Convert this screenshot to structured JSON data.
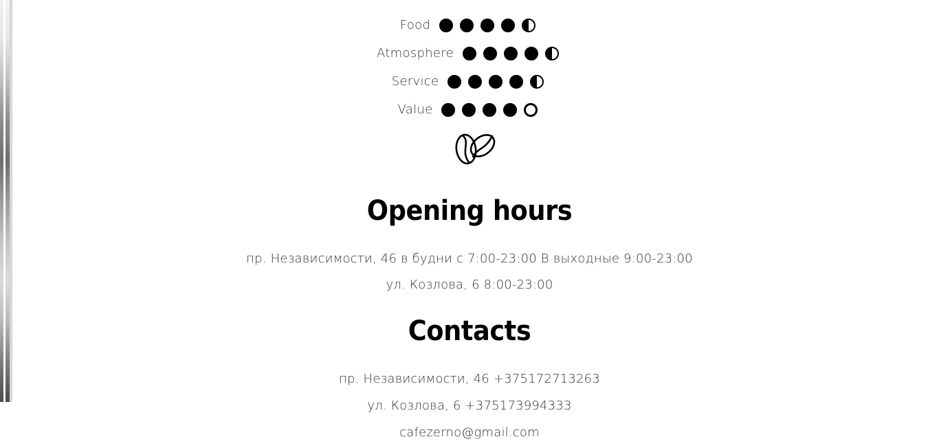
{
  "ratings": [
    {
      "label": "Food",
      "score": 4.5
    },
    {
      "label": "Atmosphere",
      "score": 4.5
    },
    {
      "label": "Service",
      "score": 4.5
    },
    {
      "label": "Value",
      "score": 4
    }
  ],
  "rating_max": 5,
  "divider_icon": "coffee-beans-icon",
  "opening_hours": {
    "title": "Opening hours",
    "lines": [
      "пр. Независимости, 46 в будни с 7:00-23:00 В выходные 9:00-23:00",
      "ул. Козлова, 6 8:00-23:00"
    ]
  },
  "contacts": {
    "title": "Contacts",
    "lines": [
      "пр. Независимости, 46 +375172713263",
      "ул. Козлова, 6 +375173994333",
      "cafezerno@gmail.com"
    ]
  },
  "colors": {
    "text": "#333333",
    "heading": "#000000",
    "dot": "#000000"
  }
}
